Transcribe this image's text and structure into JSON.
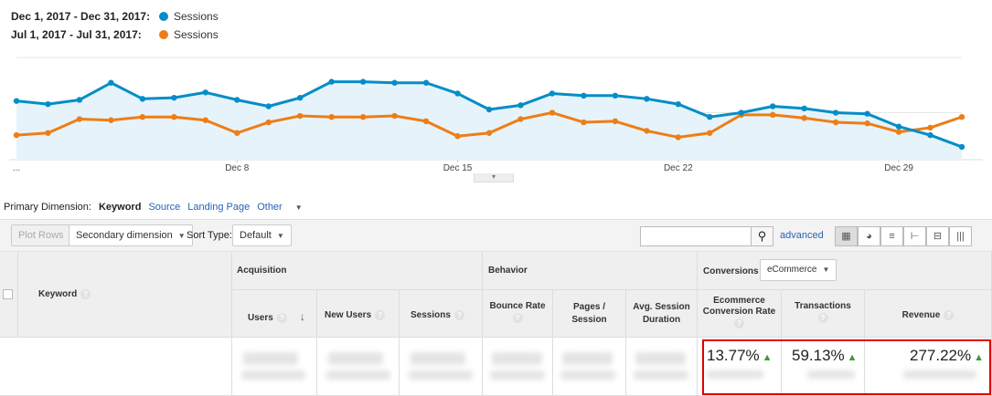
{
  "legend": [
    {
      "range": "Dec 1, 2017 - Dec 31, 2017:",
      "metric": "Sessions",
      "color": "#058dc7"
    },
    {
      "range": "Jul 1, 2017 - Jul 31, 2017:",
      "metric": "Sessions",
      "color": "#ed7e17"
    }
  ],
  "chart_data": {
    "type": "line",
    "x_ticks": [
      "...",
      "Dec 8",
      "Dec 15",
      "Dec 22",
      "Dec 29"
    ],
    "series": [
      {
        "name": "Sessions",
        "period": "Dec 1, 2017 - Dec 31, 2017",
        "color": "#058dc7",
        "values": [
          0.55,
          0.52,
          0.56,
          0.72,
          0.57,
          0.58,
          0.63,
          0.56,
          0.5,
          0.58,
          0.73,
          0.73,
          0.72,
          0.72,
          0.62,
          0.47,
          0.51,
          0.62,
          0.6,
          0.6,
          0.57,
          0.52,
          0.4,
          0.44,
          0.5,
          0.48,
          0.44,
          0.43,
          0.31,
          0.23,
          0.12
        ]
      },
      {
        "name": "Sessions",
        "period": "Jul 1, 2017 - Jul 31, 2017",
        "color": "#ed7e17",
        "values": [
          0.23,
          0.25,
          0.38,
          0.37,
          0.4,
          0.4,
          0.37,
          0.25,
          0.35,
          0.41,
          0.4,
          0.4,
          0.41,
          0.36,
          0.22,
          0.25,
          0.38,
          0.44,
          0.35,
          0.36,
          0.27,
          0.21,
          0.25,
          0.42,
          0.42,
          0.39,
          0.35,
          0.34,
          0.26,
          0.3,
          0.4
        ]
      }
    ],
    "grid": true,
    "area_fill_series": "Sessions (Dec 1, 2017 - Dec 31, 2017)"
  },
  "dimension_bar": {
    "label": "Primary Dimension:",
    "active": "Keyword",
    "links": [
      "Source",
      "Landing Page",
      "Other"
    ]
  },
  "toolbar": {
    "plot_rows": "Plot Rows",
    "secondary_dimension": "Secondary dimension",
    "sort_type_label": "Sort Type:",
    "sort_type_value": "Default",
    "advanced": "advanced",
    "search_icon": "magnifier",
    "view_icons": [
      "table-icon",
      "pie-icon",
      "performance-icon",
      "comparison-icon",
      "term-cloud-icon",
      "pivot-icon"
    ]
  },
  "table": {
    "keyword_header": "Keyword",
    "groups": {
      "acquisition": "Acquisition",
      "behavior": "Behavior",
      "conversions": "Conversions",
      "conversions_select": "eCommerce"
    },
    "columns": {
      "users": "Users",
      "new_users": "New Users",
      "sessions": "Sessions",
      "bounce_rate": "Bounce Rate",
      "pages_session": "Pages / Session",
      "avg_session": "Avg. Session Duration",
      "ecom_conv": "Ecommerce Conversion Rate",
      "transactions": "Transactions",
      "revenue": "Revenue"
    },
    "summary": {
      "ecom_conv": "13.77%",
      "transactions": "59.13%",
      "revenue": "277.22%"
    }
  },
  "colors": {
    "accent": "#058dc7",
    "compare": "#ed7e17",
    "highlight_border": "#e00000",
    "trend_up": "#3a9b3a"
  }
}
